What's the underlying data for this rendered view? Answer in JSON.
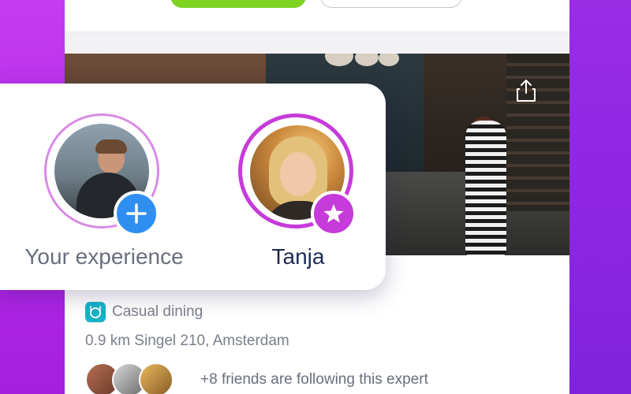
{
  "popup": {
    "user_label": "Your experience",
    "expert_label": "Tanja"
  },
  "venue": {
    "category": "Casual dining",
    "address": "0.9 km Singel 210, Amsterdam",
    "friends_text": "+8 friends are following this expert"
  },
  "colors": {
    "accent_green": "#7ed321",
    "accent_blue": "#2f8ff0",
    "accent_purple": "#c63bd9",
    "category_teal": "#18b2c8"
  },
  "icons": {
    "share": "share-icon",
    "add": "plus-icon",
    "star": "star-icon",
    "category": "dining-icon"
  }
}
